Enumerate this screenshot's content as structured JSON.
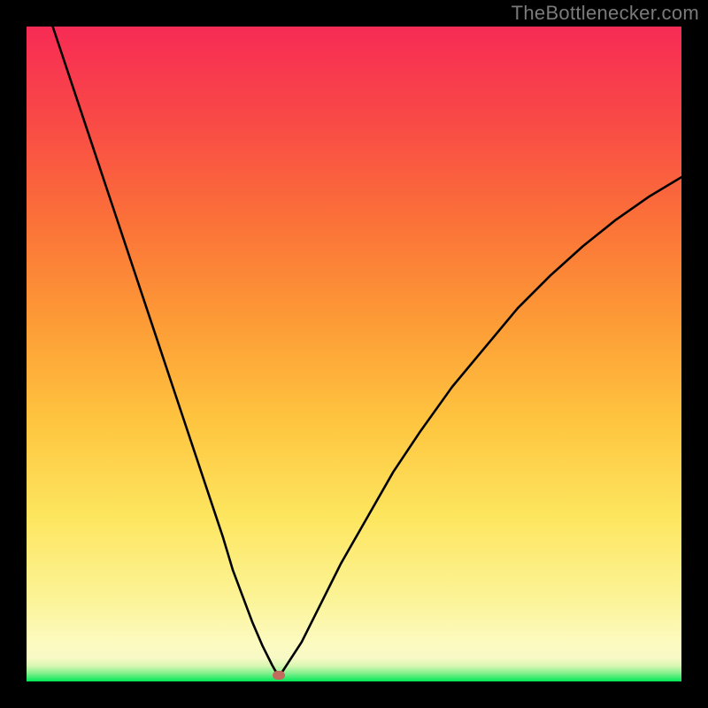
{
  "attribution": "TheBottlenecker.com",
  "colors": {
    "background": "#000000",
    "curve": "#000000",
    "marker": "#c26a5e",
    "text": "#7a7a7a"
  },
  "chart_data": {
    "type": "line",
    "title": "",
    "xlabel": "",
    "ylabel": "",
    "xlim": [
      0,
      100
    ],
    "ylim": [
      0,
      100
    ],
    "series": [
      {
        "name": "bottleneck-curve",
        "x": [
          4,
          6,
          8,
          10,
          12,
          14,
          16,
          18,
          20,
          22,
          24,
          26,
          28,
          30,
          31.5,
          33,
          34.5,
          36,
          37.5,
          38,
          38.5,
          39,
          42,
          45,
          48,
          52,
          56,
          60,
          65,
          70,
          75,
          80,
          85,
          90,
          95,
          100
        ],
        "y": [
          100,
          94,
          88,
          82,
          76,
          70,
          64,
          58,
          52,
          46,
          40,
          34,
          28,
          22,
          17,
          13,
          9,
          5.5,
          2.5,
          1.6,
          1.2,
          1.4,
          6,
          12,
          18,
          25,
          32,
          38,
          45,
          51,
          57,
          62,
          66.5,
          70.5,
          74,
          77
        ]
      }
    ],
    "marker": {
      "x": 38.5,
      "y": 1.0
    },
    "gradient_stops": [
      {
        "pct": 0,
        "color": "#00e756"
      },
      {
        "pct": 1.2,
        "color": "#7cf08a"
      },
      {
        "pct": 2.4,
        "color": "#d9f7b2"
      },
      {
        "pct": 3.6,
        "color": "#f8f9c6"
      },
      {
        "pct": 6,
        "color": "#fcfabf"
      },
      {
        "pct": 12,
        "color": "#fcf49a"
      },
      {
        "pct": 25,
        "color": "#fde65f"
      },
      {
        "pct": 40,
        "color": "#fec43f"
      },
      {
        "pct": 55,
        "color": "#fd9b36"
      },
      {
        "pct": 70,
        "color": "#fb7238"
      },
      {
        "pct": 85,
        "color": "#f94b46"
      },
      {
        "pct": 100,
        "color": "#f72b55"
      }
    ]
  }
}
